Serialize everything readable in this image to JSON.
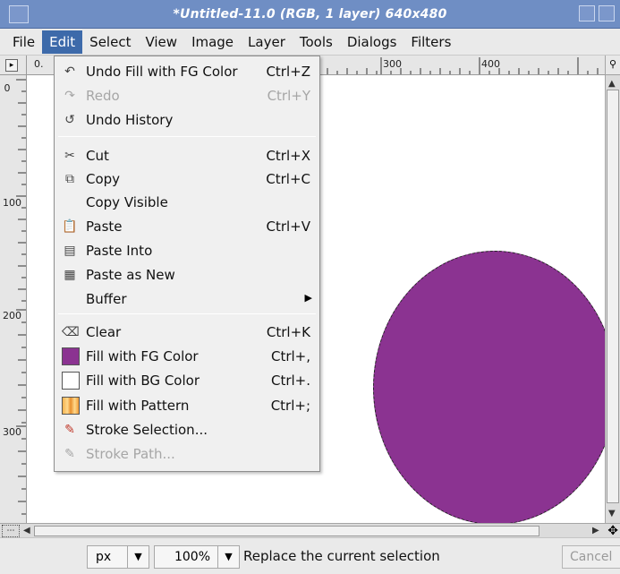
{
  "window": {
    "title": "*Untitled-11.0 (RGB, 1 layer) 640x480"
  },
  "menubar": {
    "items": [
      "File",
      "Edit",
      "Select",
      "View",
      "Image",
      "Layer",
      "Tools",
      "Dialogs",
      "Filters"
    ]
  },
  "rulers": {
    "h_visible_start": "0.",
    "h_300": "300",
    "h_400": "400",
    "v_labels": [
      "0",
      "100",
      "200",
      "300"
    ]
  },
  "canvas": {
    "fill_color": "#8b3391"
  },
  "edit_menu": {
    "items": [
      {
        "label": "Undo Fill with FG Color",
        "accel": "Ctrl+Z",
        "icon": "undo-icon",
        "enabled": true
      },
      {
        "label": "Redo",
        "accel": "Ctrl+Y",
        "icon": "redo-icon",
        "enabled": false
      },
      {
        "label": "Undo History",
        "accel": "",
        "icon": "undo-history-icon",
        "enabled": true
      },
      {
        "label": "Cut",
        "accel": "Ctrl+X",
        "icon": "cut-icon",
        "enabled": true
      },
      {
        "label": "Copy",
        "accel": "Ctrl+C",
        "icon": "copy-icon",
        "enabled": true
      },
      {
        "label": "Copy Visible",
        "accel": "",
        "icon": "",
        "enabled": true
      },
      {
        "label": "Paste",
        "accel": "Ctrl+V",
        "icon": "paste-icon",
        "enabled": true
      },
      {
        "label": "Paste Into",
        "accel": "",
        "icon": "paste-into-icon",
        "enabled": true
      },
      {
        "label": "Paste as New",
        "accel": "",
        "icon": "paste-as-new-icon",
        "enabled": true
      },
      {
        "label": "Buffer",
        "accel": "",
        "icon": "",
        "enabled": true
      },
      {
        "label": "Clear",
        "accel": "Ctrl+K",
        "icon": "clear-icon",
        "enabled": true
      },
      {
        "label": "Fill with FG Color",
        "accel": "Ctrl+,",
        "icon": "fg-color-swatch-icon",
        "enabled": true
      },
      {
        "label": "Fill with BG Color",
        "accel": "Ctrl+.",
        "icon": "bg-color-swatch-icon",
        "enabled": true
      },
      {
        "label": "Fill with Pattern",
        "accel": "Ctrl+;",
        "icon": "pattern-swatch-icon",
        "enabled": true
      },
      {
        "label": "Stroke Selection...",
        "accel": "",
        "icon": "stroke-selection-icon",
        "enabled": true
      },
      {
        "label": "Stroke Path...",
        "accel": "",
        "icon": "stroke-path-icon",
        "enabled": false
      }
    ]
  },
  "statusbar": {
    "unit": "px",
    "zoom": "100%",
    "message": "Replace the current selection",
    "cancel": "Cancel"
  }
}
